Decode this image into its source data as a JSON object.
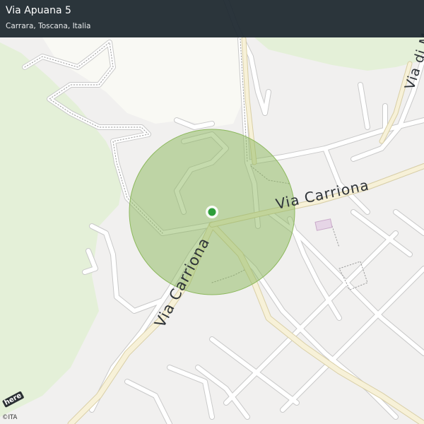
{
  "header": {
    "title": "Via Apuana 5",
    "subtitle": "Carrara, Toscana, Italia"
  },
  "map": {
    "streets": [
      {
        "name": "Via Carriona"
      },
      {
        "name": "Via Carriona"
      },
      {
        "name": "Via di Marco"
      }
    ],
    "radius_circle_color": "#8cb85c",
    "location_marker_color": "#2e9e3a",
    "park_color": "#e4f0d8",
    "road_color": "#ffffff",
    "major_road_color": "#f7f1d8"
  },
  "attribution": {
    "logo": "here",
    "copyright": "©ITA"
  }
}
